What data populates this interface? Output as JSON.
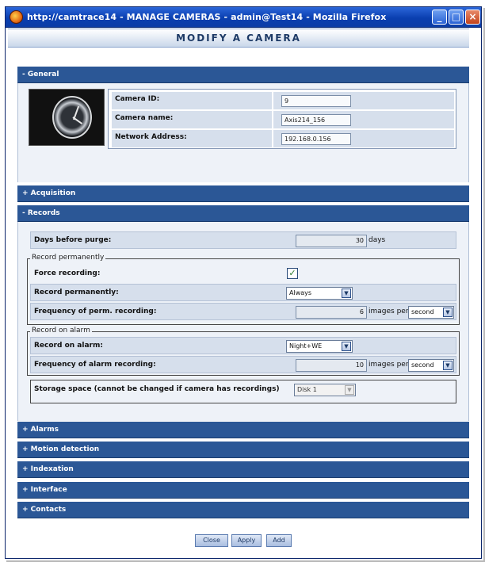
{
  "window": {
    "title": "http://camtrace14 - MANAGE CAMERAS - admin@Test14 - Mozilla Firefox",
    "controls": {
      "minimize": "_",
      "maximize": "□",
      "close": "×"
    }
  },
  "header": {
    "title": "MODIFY A CAMERA"
  },
  "sections": {
    "general": "- General",
    "acquisition": "+ Acquisition",
    "records": "- Records",
    "alarms": "+ Alarms",
    "motion_detection": "+ Motion detection",
    "indexation": "+ Indexation",
    "interface": "+ Interface",
    "contacts": "+ Contacts"
  },
  "general": {
    "camera_id_label": "Camera ID:",
    "camera_id_value": "9",
    "camera_name_label": "Camera name:",
    "camera_name_value": "Axis214_156",
    "network_address_label": "Network Address:",
    "network_address_value": "192.168.0.156"
  },
  "records": {
    "days_before_purge_label": "Days before purge:",
    "days_before_purge_value": "30",
    "days_unit": "days",
    "record_permanently_legend": "Record permanently",
    "force_recording_label": "Force recording:",
    "force_recording_checked": "✓",
    "record_permanently_label": "Record permanently:",
    "record_permanently_value": "Always",
    "freq_perm_label": "Frequency of perm. recording:",
    "freq_perm_value": "6",
    "freq_perm_unit": "images per",
    "freq_perm_period": "second",
    "record_on_alarm_legend": "Record on alarm",
    "record_on_alarm_label": "Record on alarm:",
    "record_on_alarm_value": "Night+WE",
    "freq_alarm_label": "Frequency of alarm recording:",
    "freq_alarm_value": "10",
    "freq_alarm_unit": "images per",
    "freq_alarm_period": "second",
    "storage_label": "Storage space (cannot be changed if camera has recordings)",
    "storage_value": "Disk 1"
  },
  "buttons": {
    "close": "Close",
    "apply": "Apply",
    "add": "Add"
  },
  "colors": {
    "section_bar": "#2b5796",
    "titlebar": "#0a3fb0",
    "row_bg": "#d6dfec",
    "panel_bg": "#eef2f8"
  }
}
